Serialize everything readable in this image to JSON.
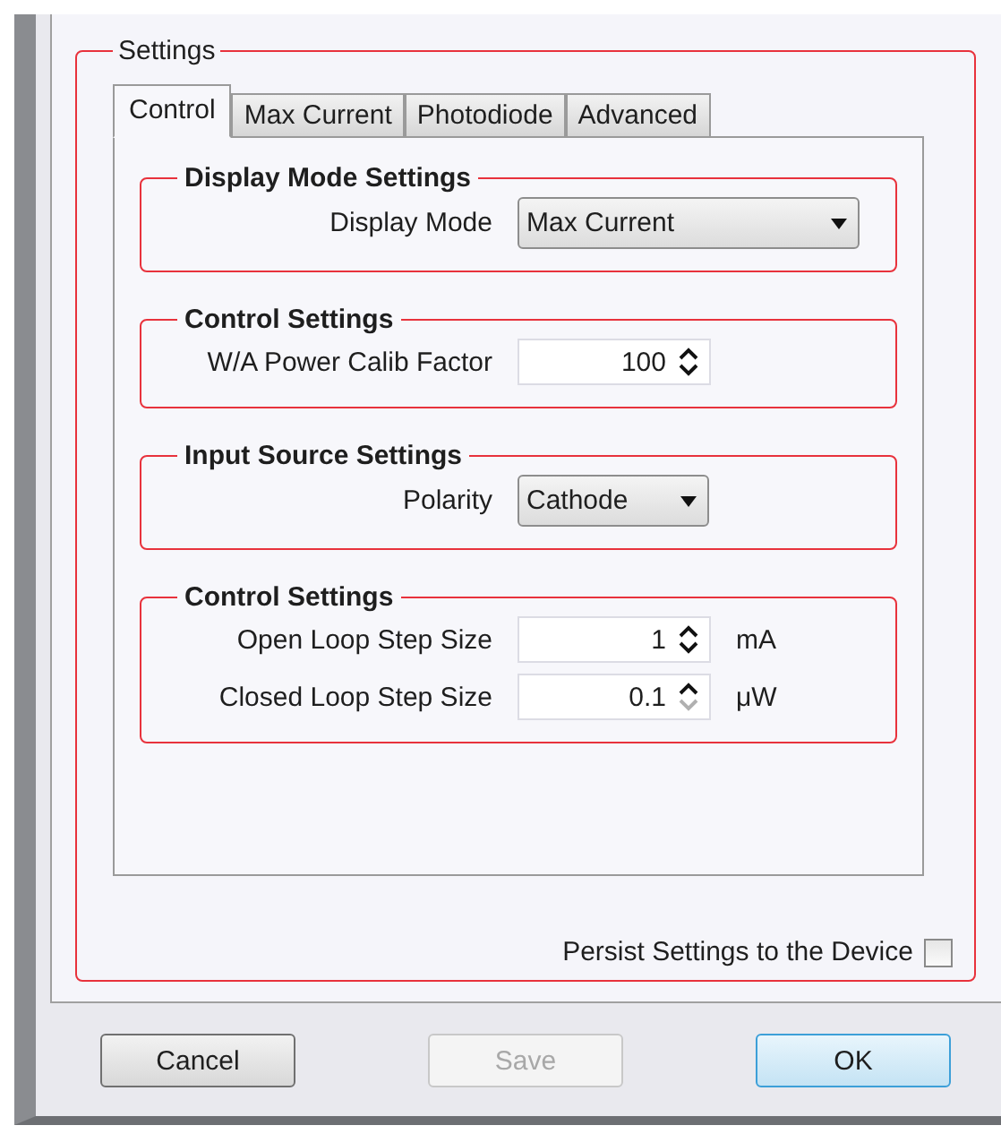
{
  "settings": {
    "title": "Settings",
    "tabs": [
      {
        "label": "Control",
        "selected": true
      },
      {
        "label": "Max Current",
        "selected": false
      },
      {
        "label": "Photodiode",
        "selected": false
      },
      {
        "label": "Advanced",
        "selected": false
      }
    ],
    "groups": [
      {
        "title": "Display Mode Settings",
        "fields": [
          {
            "kind": "dropdown",
            "label": "Display Mode",
            "value": "Max Current",
            "wide": true
          }
        ]
      },
      {
        "title": "Control Settings",
        "fields": [
          {
            "kind": "spinner",
            "label": "W/A Power Calib Factor",
            "value": "100",
            "down_disabled": false
          }
        ]
      },
      {
        "title": "Input Source Settings",
        "fields": [
          {
            "kind": "dropdown",
            "label": "Polarity",
            "value": "Cathode",
            "wide": false
          }
        ]
      },
      {
        "title": "Control Settings",
        "fields": [
          {
            "kind": "spinner",
            "label": "Open Loop Step Size",
            "value": "1",
            "unit": "mA",
            "down_disabled": false
          },
          {
            "kind": "spinner",
            "label": "Closed Loop Step Size",
            "value": "0.1",
            "unit": "μW",
            "down_disabled": true
          }
        ]
      }
    ],
    "persist": {
      "label": "Persist Settings to the Device",
      "checked": false
    }
  },
  "buttons": [
    {
      "label": "Cancel",
      "disabled": false,
      "focused": false
    },
    {
      "label": "Save",
      "disabled": true,
      "focused": false
    },
    {
      "label": "OK",
      "disabled": false,
      "focused": true
    }
  ]
}
